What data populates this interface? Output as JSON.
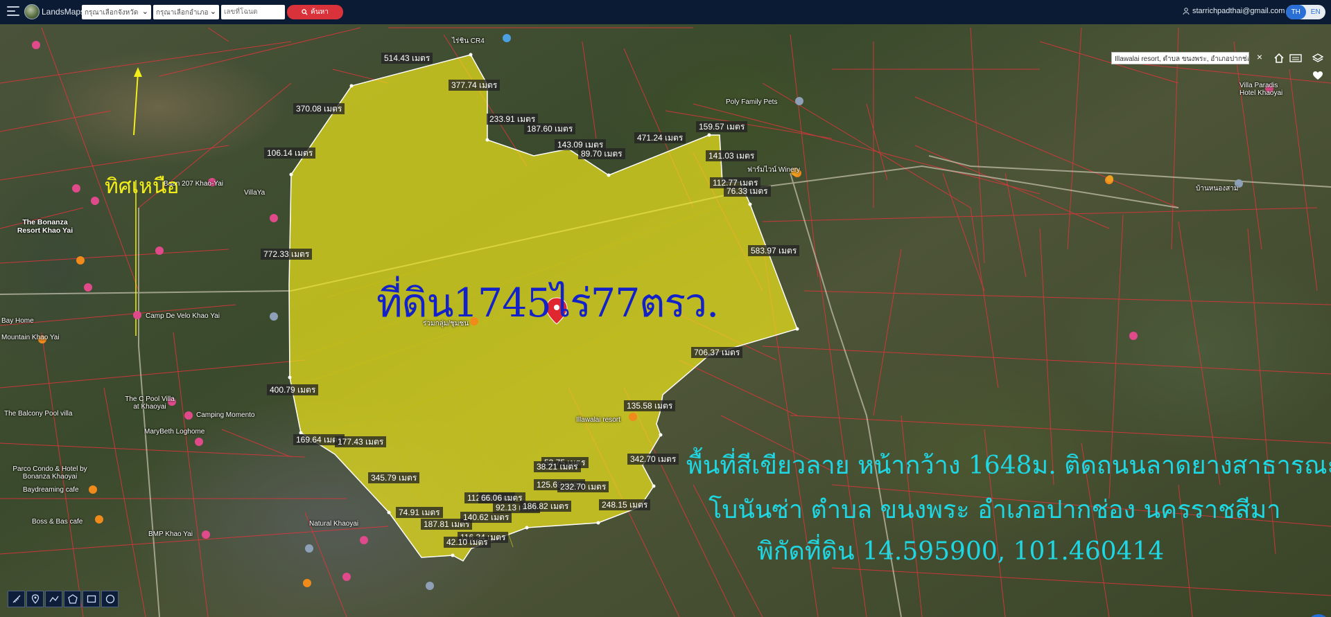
{
  "app": {
    "brand": "LandsMaps"
  },
  "topbar": {
    "province_placeholder": "กรุณาเลือกจังหวัด",
    "district_placeholder": "กรุณาเลือกอำเภอ",
    "deed_placeholder": "เลขที่โฉนด",
    "search_label": "ค้นหา",
    "user_email": "starrichpadthai@gmail.com",
    "lang_th": "TH",
    "lang_en": "EN"
  },
  "map": {
    "info_text": "Illawalai resort, ตำบล ขนงพระ, อำเภอปากช่อง",
    "title_overlay": "ที่ดิน1745ไร่77ตรว.",
    "north_label": "ทิศเหนือ",
    "description_lines": [
      "พื้นที่สีเขียวลาย หน้ากว้าง 1648ม. ติดถนนลาดยางสาธารณะ",
      "โบนันซ่า ตำบล ขนงพระ อำเภอปากช่อง นครราชสีมา",
      "พิกัดที่ดิน 14.595900, 101.460414"
    ],
    "distance_labels": [
      "514.43 เมตร",
      "377.74 เมตร",
      "370.08 เมตร",
      "233.91 เมตร",
      "187.60 เมตร",
      "143.09 เมตร",
      "89.70 เมตร",
      "471.24 เมตร",
      "159.57 เมตร",
      "141.03 เมตร",
      "112.77 เมตร",
      "76.33 เมตร",
      "106.14 เมตร",
      "772.33 เมตร",
      "583.97 เมตร",
      "706.37 เมตร",
      "400.79 เมตร",
      "135.58 เมตร",
      "169.64 เมตร",
      "177.43 เมตร",
      "342.70 เมตร",
      "53.75 เมตร",
      "38.21 เมตร",
      "345.79 เมตร",
      "125.69 เมตร",
      "232.70 เมตร",
      "112.39 เมตร",
      "66.06 เมตร",
      "92.13 เมตร",
      "186.82 เมตร",
      "248.15 เมตร",
      "74.91 เมตร",
      "187.81 เมตร",
      "140.62 เมตร",
      "116.34 เมตร",
      "42.10 เมตร"
    ],
    "places": [
      "The Bonanza Resort Khao Yai",
      "Baan 207 Khao-Yai",
      "Poly Family Pets",
      "ฟาร์มไวน์ Winery",
      "VillaYa",
      "Camp De Velo Khao Yai",
      "The C Pool Villa at Khaoyai",
      "The Balcony Pool villa",
      "Camping Momento",
      "MaryBeth Loghome",
      "Parco Condo & Hotel by Bonanza Khaoyai",
      "Baydreaming cafe",
      "Boss & Bas cafe",
      "BMP Khao Yai",
      "Natural Khaoyai",
      "Illawalai resort",
      "Villa Paradis Hotel Khaoyai",
      "ร่วมกลุ่ม/ชุมชน",
      "Mountain Khao Yai",
      "Bay Home",
      "ไร่ชิน CR4",
      "บ้านหนองสาม"
    ]
  }
}
